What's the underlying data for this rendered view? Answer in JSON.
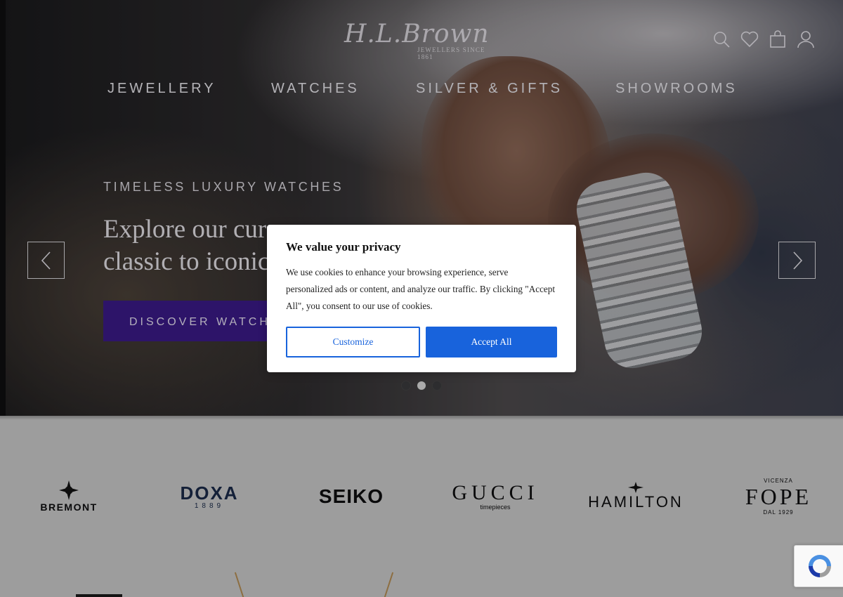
{
  "header": {
    "logo_script": "H.L.Brown",
    "logo_sub": "JEWELLERS SINCE 1861",
    "icons": [
      "search-icon",
      "heart-icon",
      "bag-icon",
      "user-icon"
    ]
  },
  "nav": {
    "items": [
      {
        "label": "JEWELLERY"
      },
      {
        "label": "WATCHES"
      },
      {
        "label": "SILVER & GIFTS"
      },
      {
        "label": "SHOWROOMS"
      }
    ]
  },
  "hero": {
    "eyebrow": "TIMELESS LUXURY WATCHES",
    "headline_line1": "Explore our cura",
    "headline_line2": "classic to iconic,",
    "cta_label": "DISCOVER WATCHES",
    "slides_total": 3,
    "active_slide": 2
  },
  "cookie_modal": {
    "title": "We value your privacy",
    "body": "We use cookies to enhance your browsing experience, serve personalized ads or content, and analyze our traffic. By clicking \"Accept All\", you consent to our use of cookies.",
    "customize_label": "Customize",
    "accept_label": "Accept All"
  },
  "brands": {
    "bremont": "BREMONT",
    "doxa": "DOXA",
    "doxa_sub": "1889",
    "seiko": "SEIKO",
    "gucci": "GUCCI",
    "gucci_sub": "timepieces",
    "hamilton": "HAMILTON",
    "fope_top": "VICENZA",
    "fope": "FOPE",
    "fope_sub": "DAL 1929"
  },
  "colors": {
    "cta_bg": "#3a1a87",
    "accept_bg": "#1863dc",
    "modal_bg": "#ffffff"
  }
}
